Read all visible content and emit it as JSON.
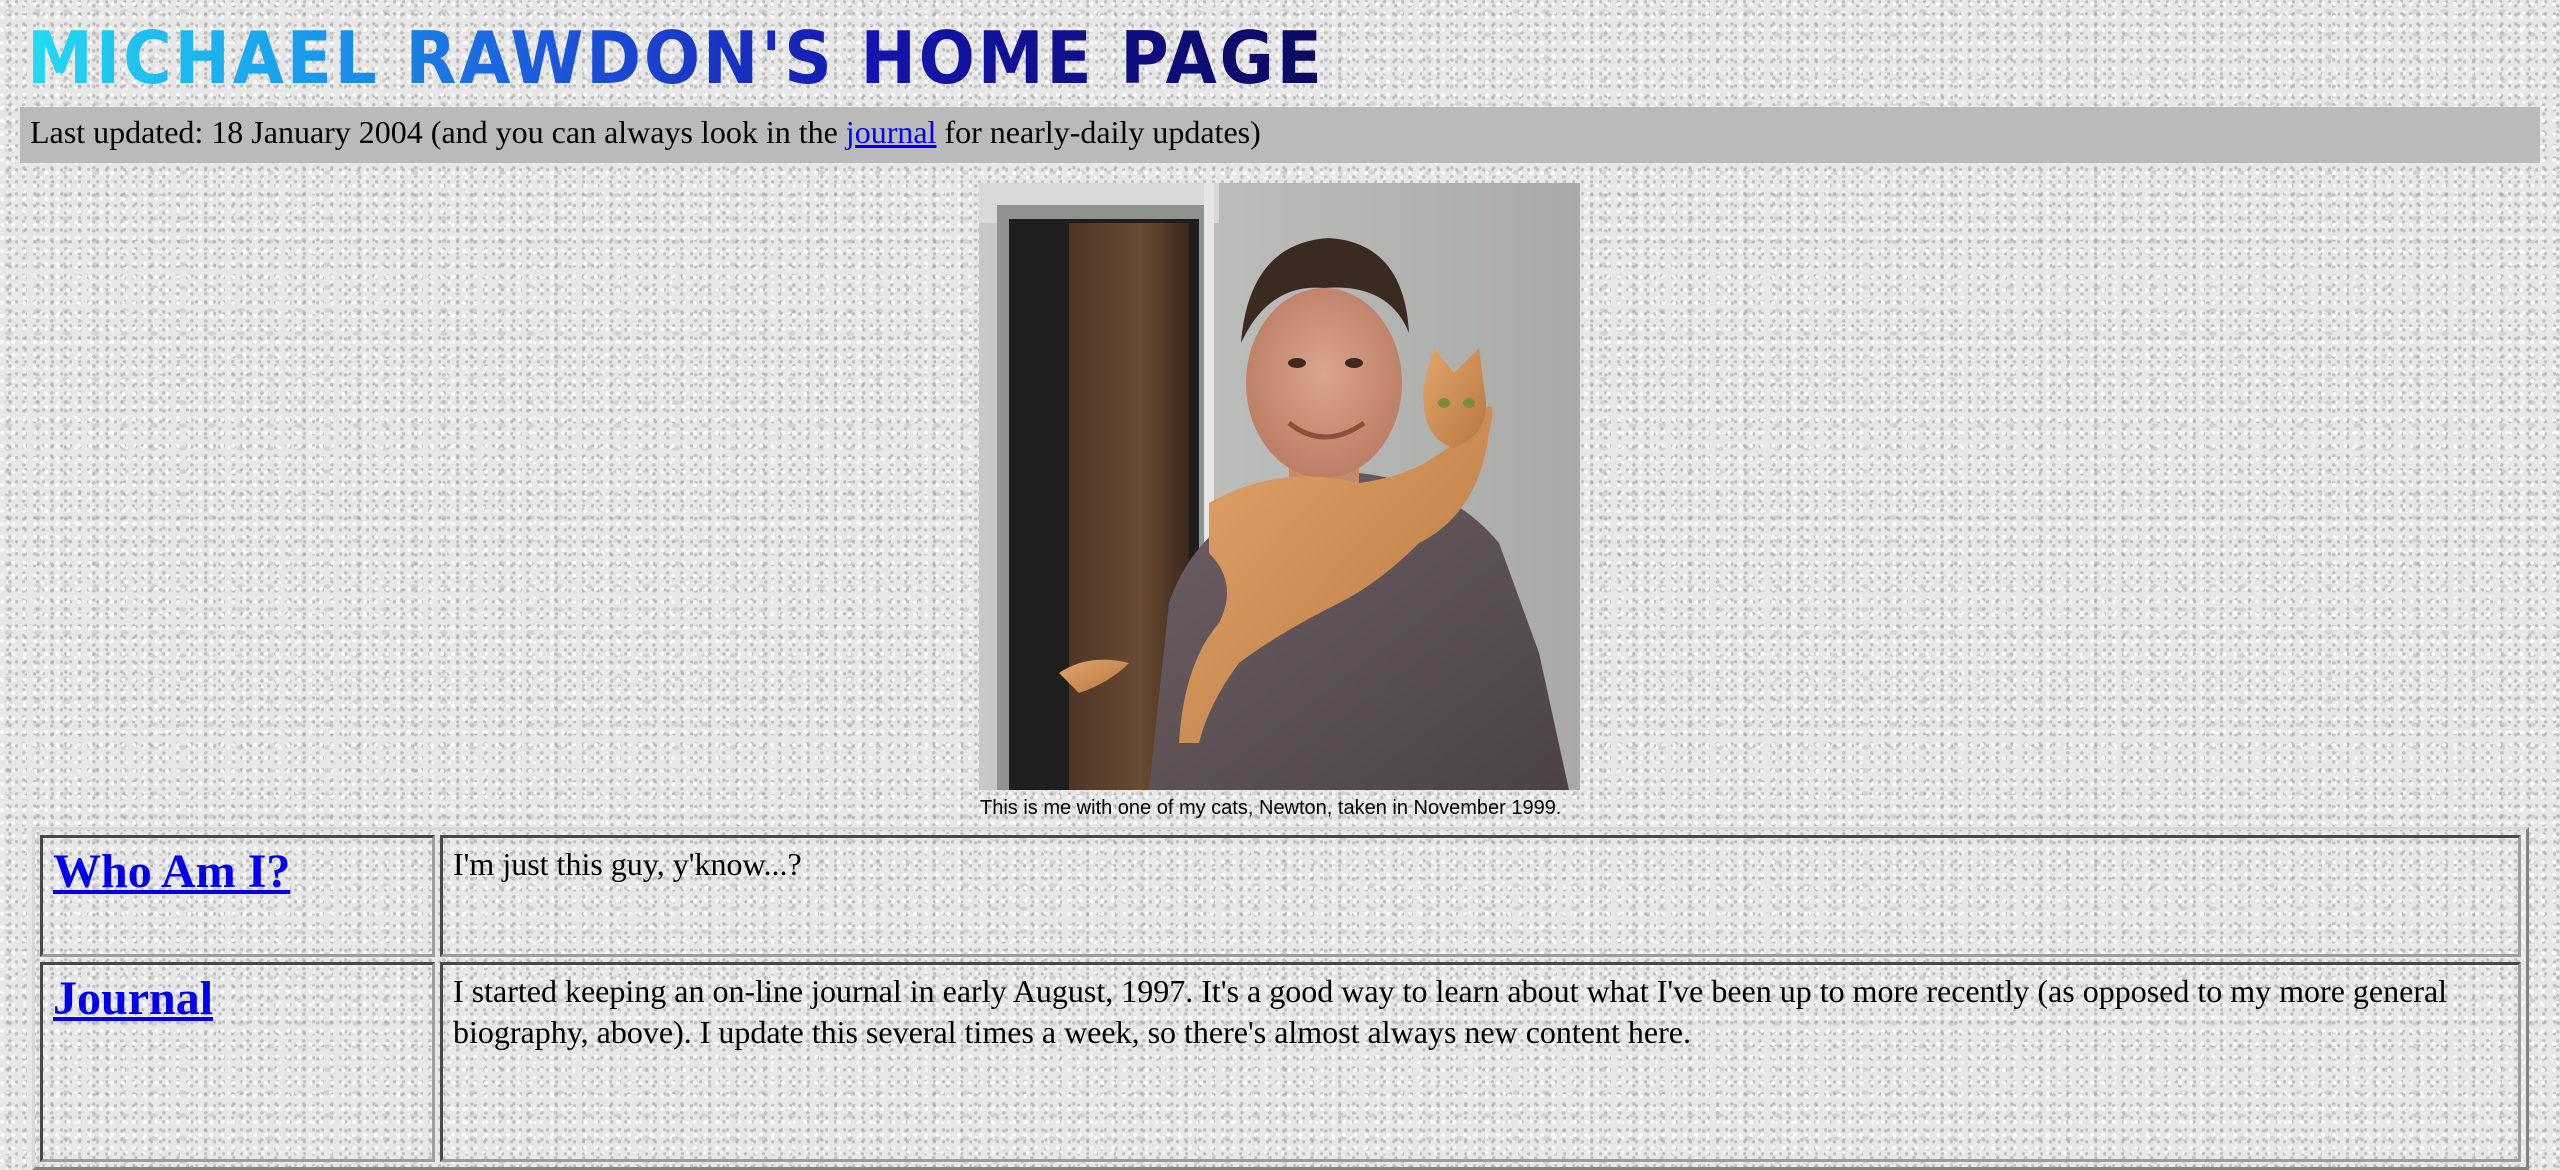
{
  "header": {
    "title": "MICHAEL RAWDON'S HOME PAGE"
  },
  "update_bar": {
    "prefix": "Last updated: 18 January 2004 (and you can always look in the",
    "link_text": "journal",
    "suffix": "for nearly-daily updates)"
  },
  "photo": {
    "caption": "This is me with one of my cats, Newton, taken in November 1999."
  },
  "sections": [
    {
      "title": "Who Am I?",
      "body": "I'm just this guy, y'know...?"
    },
    {
      "title": "Journal",
      "body": "I started keeping an on-line journal in early August, 1997. It's a good way to learn about what I've been up to more recently (as opposed to my more general biography, above). I update this several times a week, so there's almost always new content here."
    }
  ],
  "colors": {
    "link": "#0000ee",
    "update_bar_bg": "#bababa",
    "title_gradient_start": "#22dbf2",
    "title_gradient_end": "#0a0a5e"
  }
}
